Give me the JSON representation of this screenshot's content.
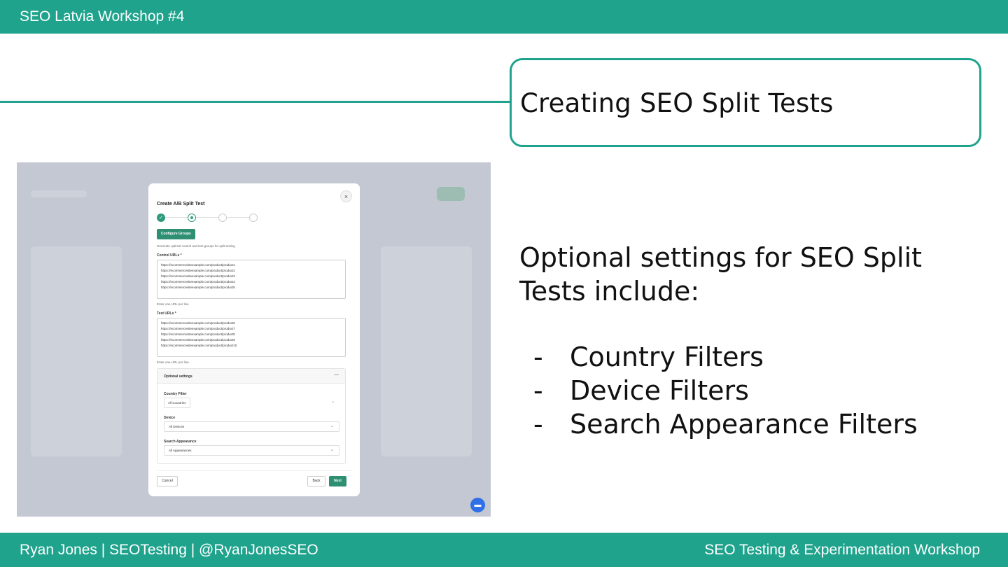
{
  "header": {
    "title": "SEO Latvia Workshop #4"
  },
  "slide": {
    "title": "Creating SEO Split Tests",
    "intro": "Optional settings for SEO Split Tests include:",
    "bullets": [
      "Country Filters",
      "Device Filters",
      "Search Appearance Filters"
    ],
    "bullet_marker": "-"
  },
  "screenshot": {
    "modal": {
      "title": "Create A/B Split Test",
      "close_icon": "×",
      "configure_button": "Configure Groups",
      "description": "Generate optimal control and test groups for split testing",
      "control_label": "Control URLs *",
      "control_urls": [
        "https://ecommercesiteexample.com/product/product1",
        "https://ecommercesiteexample.com/product/product2",
        "https://ecommercesiteexample.com/product/product3",
        "https://ecommercesiteexample.com/product/product4",
        "https://ecommercesiteexample.com/product/product5"
      ],
      "control_hint": "Enter one URL per line",
      "test_label": "Test URLs *",
      "test_urls": [
        "https://ecommercesiteexample.com/product/product6",
        "https://ecommercesiteexample.com/product/product7",
        "https://ecommercesiteexample.com/product/product8",
        "https://ecommercesiteexample.com/product/product9",
        "https://ecommercesiteexample.com/product/product10"
      ],
      "test_hint": "Enter one URL per line",
      "optional": {
        "heading": "Optional settings",
        "collapse_icon": "—",
        "country_label": "Country Filter",
        "country_value": "All Countries",
        "device_label": "Device",
        "device_value": "All Devices",
        "appearance_label": "Search Appearance",
        "appearance_value": "All Appearances"
      },
      "cancel": "Cancel",
      "back": "Back",
      "next": "Next"
    }
  },
  "footer": {
    "left": "Ryan Jones | SEOTesting | @RyanJonesSEO",
    "right": "SEO Testing & Experimentation Workshop"
  },
  "colors": {
    "brand": "#1fa38c",
    "button": "#2f8f73",
    "chat": "#2f6fe8"
  }
}
